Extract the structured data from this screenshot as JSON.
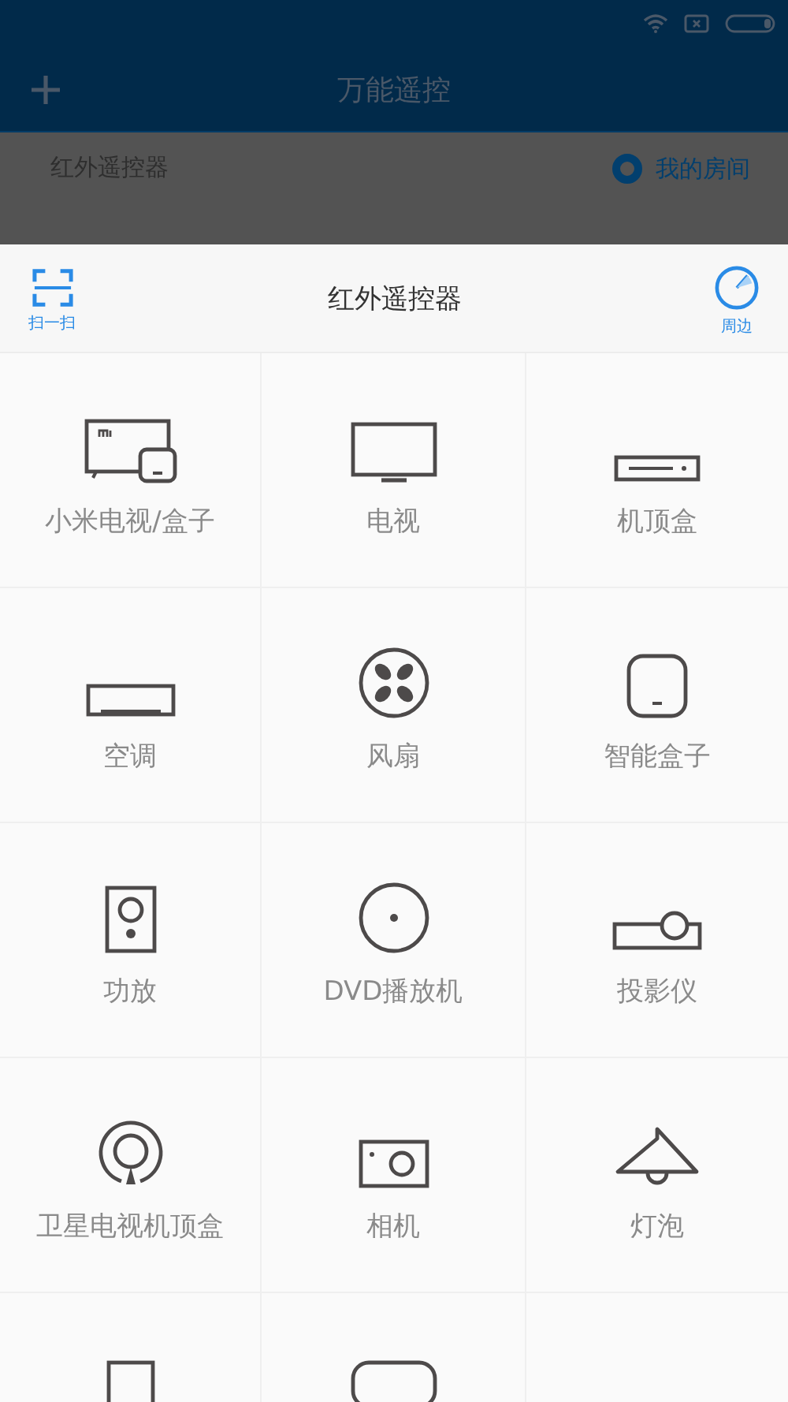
{
  "app_bar": {
    "title": "万能遥控"
  },
  "section": {
    "title": "红外遥控器",
    "room_link": "我的房间"
  },
  "sheet": {
    "title": "红外遥控器",
    "scan_label": "扫一扫",
    "nearby_label": "周边"
  },
  "devices": [
    {
      "kind": "mitv",
      "label": "小米电视/盒子"
    },
    {
      "kind": "tv",
      "label": "电视"
    },
    {
      "kind": "stb",
      "label": "机顶盒"
    },
    {
      "kind": "ac",
      "label": "空调"
    },
    {
      "kind": "fan",
      "label": "风扇"
    },
    {
      "kind": "box",
      "label": "智能盒子"
    },
    {
      "kind": "amp",
      "label": "功放"
    },
    {
      "kind": "dvd",
      "label": "DVD播放机"
    },
    {
      "kind": "projector",
      "label": "投影仪"
    },
    {
      "kind": "satellite",
      "label": "卫星电视机顶盒"
    },
    {
      "kind": "camera",
      "label": "相机"
    },
    {
      "kind": "lamp",
      "label": "灯泡"
    },
    {
      "kind": "tall"
    },
    {
      "kind": "wide"
    }
  ]
}
